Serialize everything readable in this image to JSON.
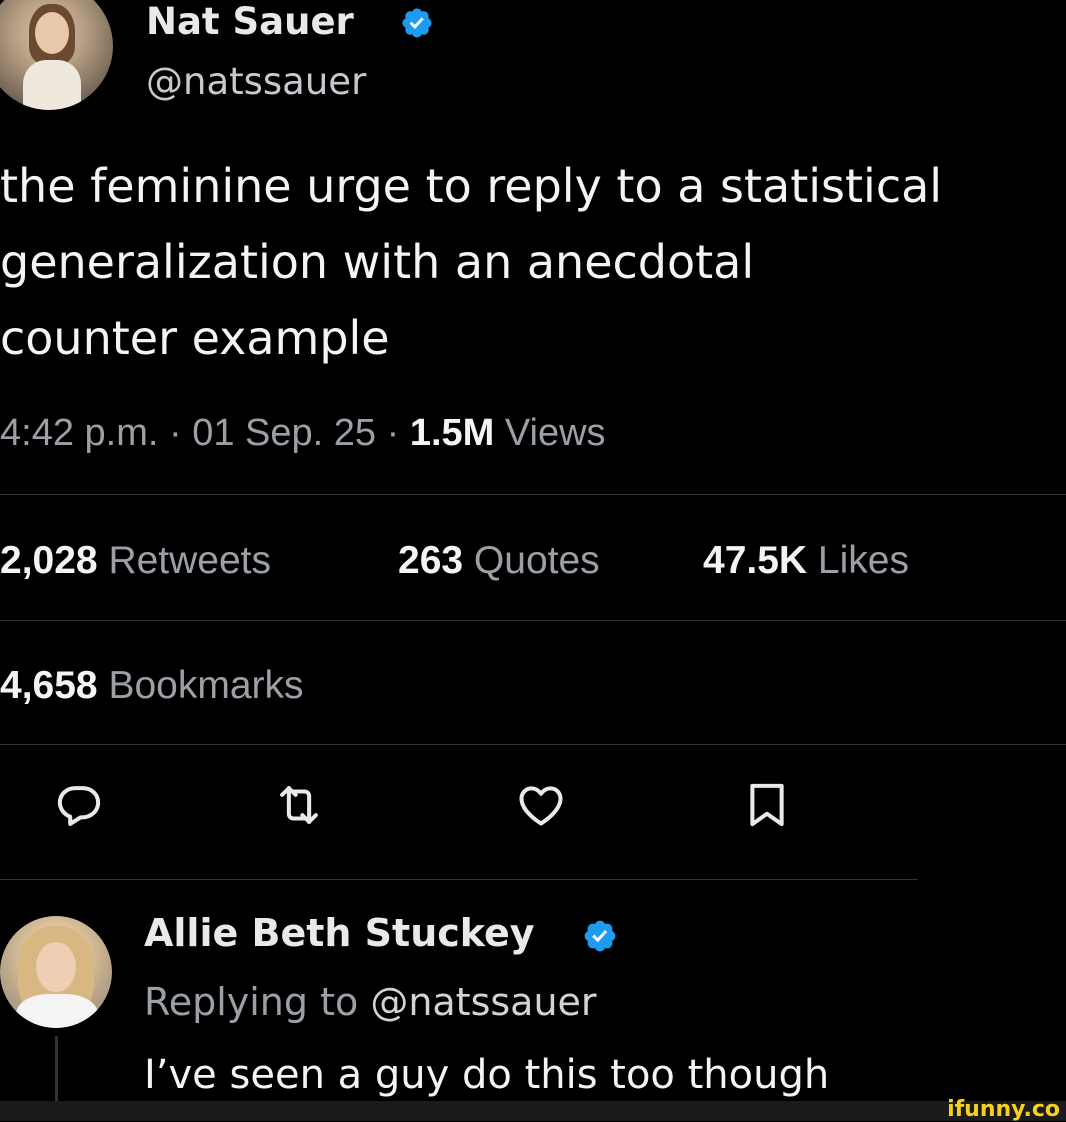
{
  "tweet": {
    "author": {
      "name": "Nat Sauer",
      "handle": "@natssauer"
    },
    "text": "the feminine urge to reply to a statistical\ngeneralization with an anecdotal\ncounter example",
    "meta": {
      "time": "4:42 p.m.",
      "separator": " · ",
      "date": "01 Sep. 25",
      "views_count": "1.5M",
      "views_label": " Views"
    },
    "stats": {
      "retweets_count": "2,028",
      "retweets_label": " Retweets",
      "quotes_count": "263",
      "quotes_label": " Quotes",
      "likes_count": "47.5K",
      "likes_label": " Likes",
      "bookmarks_count": "4,658",
      "bookmarks_label": " Bookmarks"
    },
    "actions": [
      "reply-icon",
      "retweet-icon",
      "like-icon",
      "bookmark-icon"
    ]
  },
  "reply": {
    "author": {
      "name": "Allie Beth Stuckey"
    },
    "replying_prefix": "Replying to ",
    "replying_handle": "@natssauer",
    "text": "I’ve seen a guy do this too though"
  },
  "watermark": "ifunny.co",
  "colors": {
    "background": "#000000",
    "verified_badge": "#1d9bf0",
    "divider": "#2f3336",
    "muted_text": "#9aa0a6",
    "watermark": "#f5d020"
  }
}
